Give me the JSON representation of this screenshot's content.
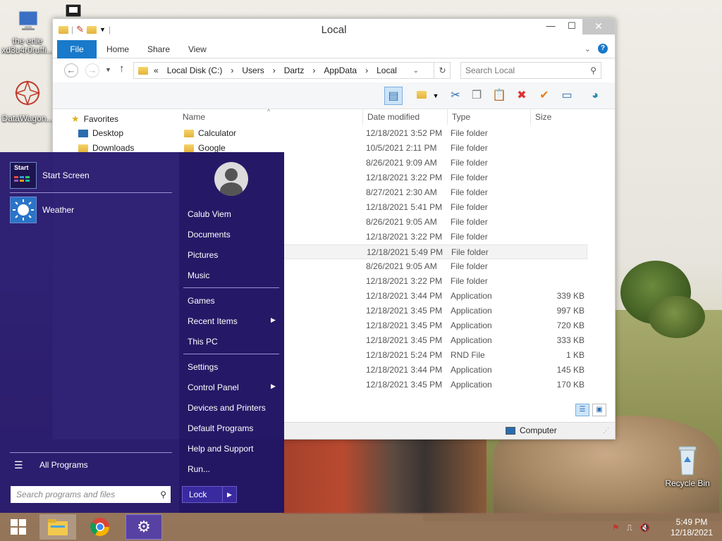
{
  "desktop": {
    "icons": [
      {
        "label_line1": "the enie",
        "label_line2": "xd3u4r0ruffi..."
      },
      {
        "label_line1": "DataWagon...",
        "label_line2": ""
      },
      {
        "label_line1": "Recycle Bin",
        "label_line2": ""
      }
    ]
  },
  "window": {
    "title": "Local",
    "controls": {
      "minimize": "—",
      "maximize": "☐",
      "close": "✕"
    },
    "tabs": [
      "File",
      "Home",
      "Share",
      "View"
    ],
    "help": "?",
    "address": {
      "crumbs": [
        "«",
        "Local Disk (C:)",
        "›",
        "Users",
        "›",
        "Dartz",
        "›",
        "AppData",
        "›",
        "Local"
      ]
    },
    "search_placeholder": "Search Local",
    "nav": {
      "favorites": "Favorites",
      "items": [
        "Desktop",
        "Downloads"
      ]
    },
    "columns": {
      "name": "Name",
      "date": "Date modified",
      "type": "Type",
      "size": "Size"
    },
    "rows": [
      {
        "name": "Calculator",
        "date": "12/18/2021 3:52 PM",
        "type": "File folder",
        "size": ""
      },
      {
        "name": "Google",
        "date": "10/5/2021 2:11 PM",
        "type": "File folder",
        "size": ""
      },
      {
        "name": "",
        "date": "8/26/2021 9:09 AM",
        "type": "File folder",
        "size": ""
      },
      {
        "name": "",
        "date": "12/18/2021 3:22 PM",
        "type": "File folder",
        "size": ""
      },
      {
        "name": "",
        "date": "8/27/2021 2:30 AM",
        "type": "File folder",
        "size": ""
      },
      {
        "name": "",
        "date": "12/18/2021 5:41 PM",
        "type": "File folder",
        "size": ""
      },
      {
        "name": "",
        "date": "8/26/2021 9:05 AM",
        "type": "File folder",
        "size": ""
      },
      {
        "name": "",
        "date": "12/18/2021 3:22 PM",
        "type": "File folder",
        "size": ""
      },
      {
        "name": "",
        "date": "12/18/2021 5:49 PM",
        "type": "File folder",
        "size": ""
      },
      {
        "name": "",
        "date": "8/26/2021 9:05 AM",
        "type": "File folder",
        "size": ""
      },
      {
        "name": "",
        "date": "12/18/2021 3:22 PM",
        "type": "File folder",
        "size": ""
      },
      {
        "name": "",
        "date": "12/18/2021 3:44 PM",
        "type": "Application",
        "size": "339 KB"
      },
      {
        "name": "",
        "date": "12/18/2021 3:45 PM",
        "type": "Application",
        "size": "997 KB"
      },
      {
        "name": "",
        "date": "12/18/2021 3:45 PM",
        "type": "Application",
        "size": "720 KB"
      },
      {
        "name": "",
        "date": "12/18/2021 3:45 PM",
        "type": "Application",
        "size": "333 KB"
      },
      {
        "name": "",
        "date": "12/18/2021 5:24 PM",
        "type": "RND File",
        "size": "1 KB"
      },
      {
        "name": "",
        "date": "12/18/2021 3:44 PM",
        "type": "Application",
        "size": "145 KB"
      },
      {
        "name": "",
        "date": "12/18/2021 3:45 PM",
        "type": "Application",
        "size": "170 KB"
      }
    ],
    "selected_row_index": 8,
    "status_computer": "Computer"
  },
  "start_menu": {
    "tiles": [
      {
        "tile_text": "Start",
        "label": "Start Screen"
      },
      {
        "tile_text": "",
        "label": "Weather"
      }
    ],
    "all_programs": "All Programs",
    "search_placeholder": "Search programs and files",
    "user": "Calub Viem",
    "right_items": [
      {
        "label": "Documents",
        "arrow": ""
      },
      {
        "label": "Pictures",
        "arrow": ""
      },
      {
        "label": "Music",
        "arrow": ""
      },
      {
        "label": "Games",
        "arrow": ""
      },
      {
        "label": "Recent Items",
        "arrow": "▶"
      },
      {
        "label": "This PC",
        "arrow": ""
      },
      {
        "label": "Settings",
        "arrow": ""
      },
      {
        "label": "Control Panel",
        "arrow": "▶"
      },
      {
        "label": "Devices and Printers",
        "arrow": ""
      },
      {
        "label": "Default Programs",
        "arrow": ""
      },
      {
        "label": "Help and Support",
        "arrow": ""
      },
      {
        "label": "Run...",
        "arrow": ""
      }
    ],
    "lock": "Lock",
    "lock_arrow": "▶"
  },
  "taskbar": {
    "time": "5:49 PM",
    "date": "12/18/2021"
  },
  "colors": {
    "accent": "#1979ca",
    "start_bg": "#28196e"
  }
}
